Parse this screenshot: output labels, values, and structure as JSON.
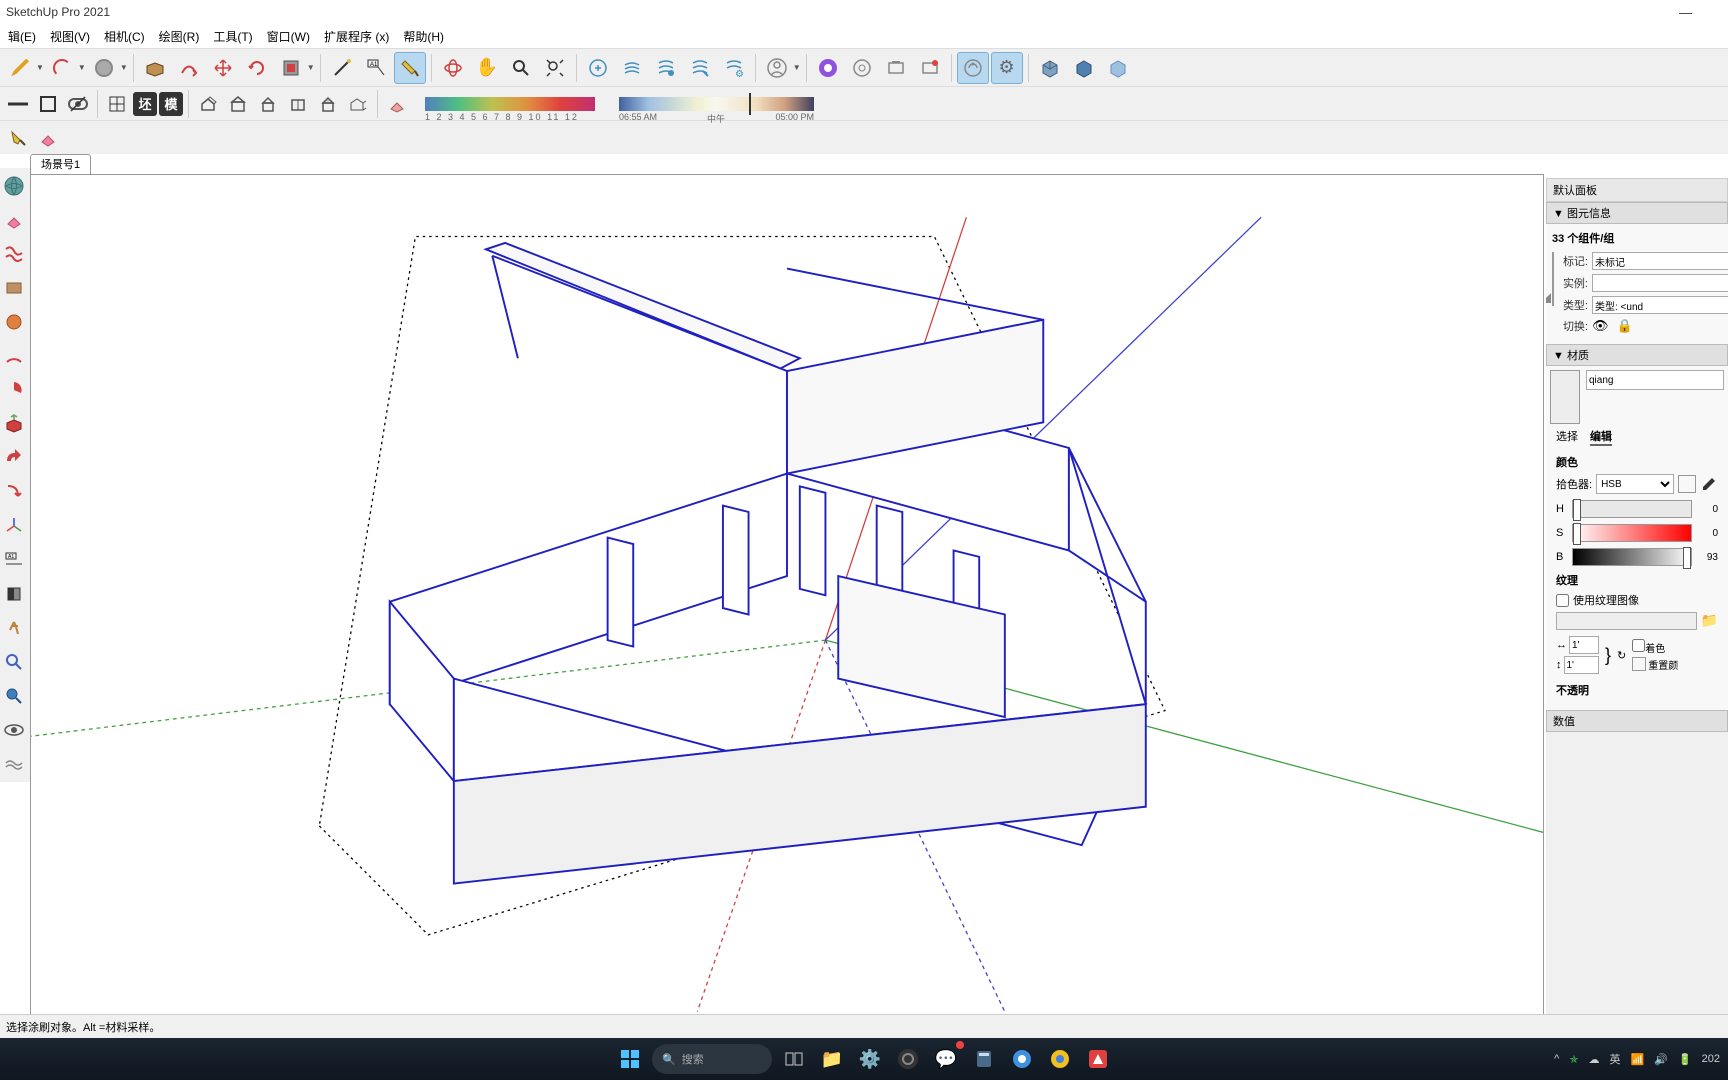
{
  "app": {
    "title": "SketchUp Pro 2021"
  },
  "menu": {
    "items": [
      "辑(E)",
      "视图(V)",
      "相机(C)",
      "绘图(R)",
      "工具(T)",
      "窗口(W)",
      "扩展程序 (x)",
      "帮助(H)"
    ]
  },
  "time_slider": {
    "start": "06:55 AM",
    "mid": "中午",
    "end": "05:00 PM"
  },
  "color_scale": {
    "numbers": "1  2  3  4  5  6  7  8  9  10 11 12"
  },
  "scene": {
    "tab1": "场景号1"
  },
  "right_panel": {
    "default_title": "默认面板",
    "entity_info": {
      "title": "图元信息",
      "count_label": "33 个组件/组",
      "tag_label": "标记:",
      "tag_value": "未标记",
      "instance_label": "实例:",
      "type_label": "类型:",
      "type_value": "类型: <und",
      "toggle_label": "切换:"
    },
    "material": {
      "title": "材质",
      "name": "qiang",
      "tab_select": "选择",
      "tab_edit": "编辑",
      "color_title": "颜色",
      "picker_label": "拾色器:",
      "picker_mode": "HSB",
      "h_label": "H",
      "h_val": "0",
      "s_label": "S",
      "s_val": "0",
      "b_label": "B",
      "b_val": "93",
      "texture_title": "纹理",
      "use_texture": "使用纹理图像",
      "dim1": "1'",
      "dim2": "1'",
      "colorize": "着色",
      "reset_color": "重置颜",
      "opacity_title": "不透明",
      "value_title": "数值"
    }
  },
  "statusbar": {
    "text": "选择涂刷对象。Alt =材料采样。"
  },
  "taskbar": {
    "search": "搜索",
    "lang": "英",
    "year": "202"
  }
}
